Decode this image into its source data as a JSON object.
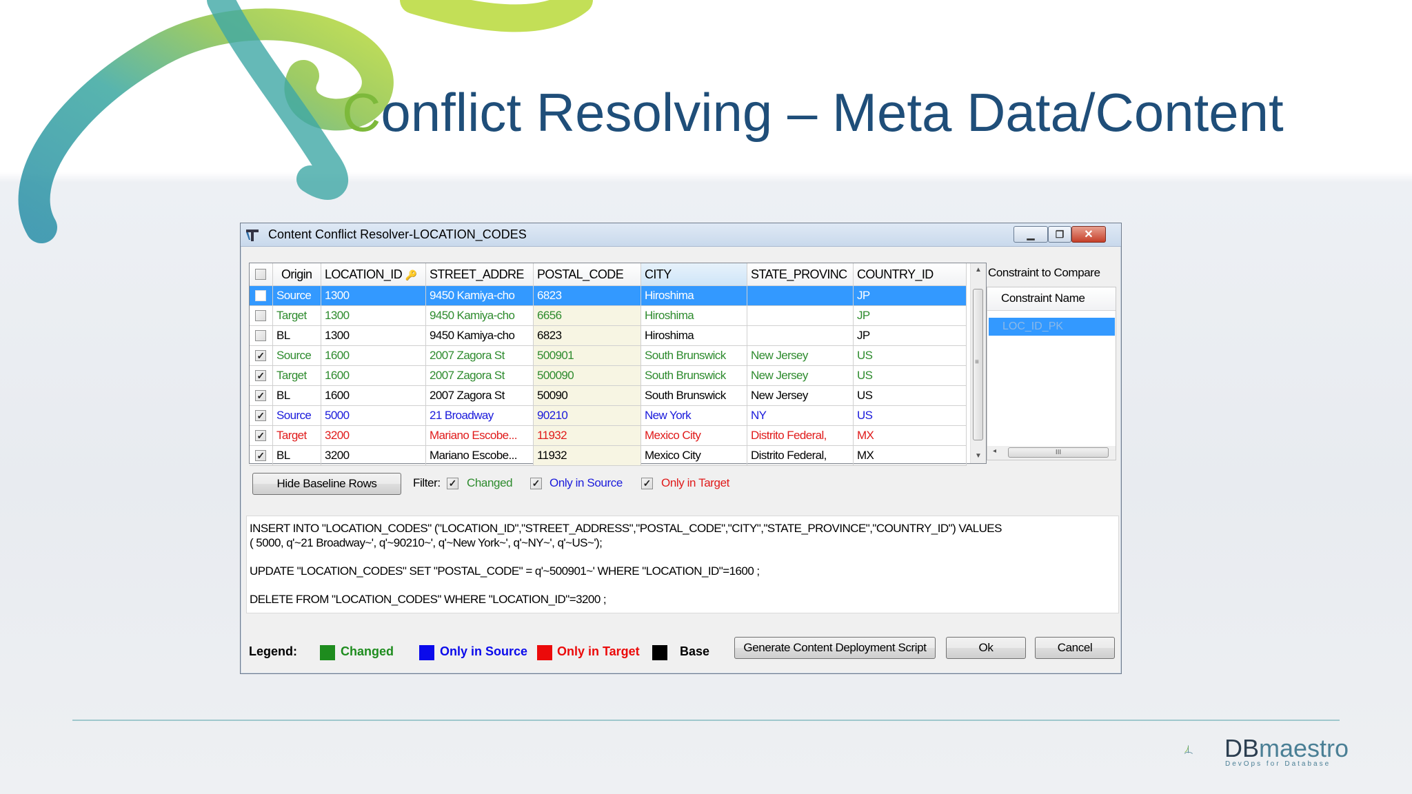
{
  "slide": {
    "title_first": "C",
    "title_rest": "onflict Resolving – Meta Data/Content",
    "logo_name_db": "DB",
    "logo_name_rest": "maestro",
    "logo_tagline": "DevOps for Database"
  },
  "window": {
    "title": "Content Conflict Resolver-LOCATION_CODES",
    "controls": [
      "minimize",
      "restore",
      "close"
    ]
  },
  "grid": {
    "columns": [
      "Origin",
      "LOCATION_ID",
      "STREET_ADDRE",
      "POSTAL_CODE",
      "CITY",
      "STATE_PROVINC",
      "COUNTRY_ID"
    ],
    "sorted_column": "CITY",
    "rows": [
      {
        "checked": false,
        "origin": "Source",
        "location_id": "1300",
        "street": "9450 Kamiya-cho",
        "postal": "6823",
        "city": "Hiroshima",
        "state": "",
        "country": "JP",
        "color": "#2e8b2e",
        "selected": true
      },
      {
        "checked": false,
        "origin": "Target",
        "location_id": "1300",
        "street": "9450 Kamiya-cho",
        "postal": "6656",
        "city": "Hiroshima",
        "state": "",
        "country": "JP",
        "color": "#2e8b2e",
        "selected": false
      },
      {
        "checked": false,
        "origin": "BL",
        "location_id": "1300",
        "street": "9450 Kamiya-cho",
        "postal": "6823",
        "city": "Hiroshima",
        "state": "",
        "country": "JP",
        "color": "#000000",
        "selected": false
      },
      {
        "checked": true,
        "origin": "Source",
        "location_id": "1600",
        "street": "2007 Zagora St",
        "postal": "500901",
        "city": "South Brunswick",
        "state": "New Jersey",
        "country": "US",
        "color": "#2e8b2e",
        "selected": false
      },
      {
        "checked": true,
        "origin": "Target",
        "location_id": "1600",
        "street": "2007 Zagora St",
        "postal": "500090",
        "city": "South Brunswick",
        "state": "New Jersey",
        "country": "US",
        "color": "#2e8b2e",
        "selected": false
      },
      {
        "checked": true,
        "origin": "BL",
        "location_id": "1600",
        "street": "2007 Zagora St",
        "postal": "50090",
        "city": "South Brunswick",
        "state": "New Jersey",
        "country": "US",
        "color": "#000000",
        "selected": false
      },
      {
        "checked": true,
        "origin": "Source",
        "location_id": "5000",
        "street": "21 Broadway",
        "postal": "90210",
        "city": "New York",
        "state": "NY",
        "country": "US",
        "color": "#1a1adb",
        "selected": false
      },
      {
        "checked": true,
        "origin": "Target",
        "location_id": "3200",
        "street": "Mariano Escobe...",
        "postal": "11932",
        "city": "Mexico City",
        "state": "Distrito Federal,",
        "country": "MX",
        "color": "#e01b1b",
        "selected": false
      },
      {
        "checked": true,
        "origin": "BL",
        "location_id": "3200",
        "street": "Mariano Escobe...",
        "postal": "11932",
        "city": "Mexico City",
        "state": "Distrito Federal,",
        "country": "MX",
        "color": "#000000",
        "selected": false
      }
    ]
  },
  "constraint_panel": {
    "title": "Constraint to Compare",
    "column_header": "Constraint Name",
    "items": [
      "LOC_ID_PK"
    ],
    "scroll_glyph": "III"
  },
  "filter": {
    "hide_button": "Hide Baseline Rows",
    "label": "Filter:",
    "options": [
      {
        "label": "Changed",
        "checked": true,
        "color": "#2e8b2e"
      },
      {
        "label": "Only in Source",
        "checked": true,
        "color": "#1a1adb"
      },
      {
        "label": "Only in Target",
        "checked": true,
        "color": "#e01b1b"
      }
    ]
  },
  "sql": {
    "lines": [
      "INSERT INTO \"LOCATION_CODES\" (\"LOCATION_ID\",\"STREET_ADDRESS\",\"POSTAL_CODE\",\"CITY\",\"STATE_PROVINCE\",\"COUNTRY_ID\") VALUES",
      "( 5000, q'~21 Broadway~', q'~90210~', q'~New York~', q'~NY~', q'~US~');",
      "UPDATE \"LOCATION_CODES\" SET \"POSTAL_CODE\" =  q'~500901~' WHERE  \"LOCATION_ID\"=1600 ;",
      "DELETE FROM \"LOCATION_CODES\" WHERE  \"LOCATION_ID\"=3200 ;"
    ]
  },
  "legend": {
    "label": "Legend:",
    "items": [
      {
        "label": "Changed",
        "color": "#1e8c1e"
      },
      {
        "label": "Only in Source",
        "color": "#0a0aeb"
      },
      {
        "label": "Only in Target",
        "color": "#eb0a0a"
      },
      {
        "label": "Base",
        "color": "#000000"
      }
    ]
  },
  "buttons": {
    "generate": "Generate Content Deployment Script",
    "ok": "Ok",
    "cancel": "Cancel"
  }
}
